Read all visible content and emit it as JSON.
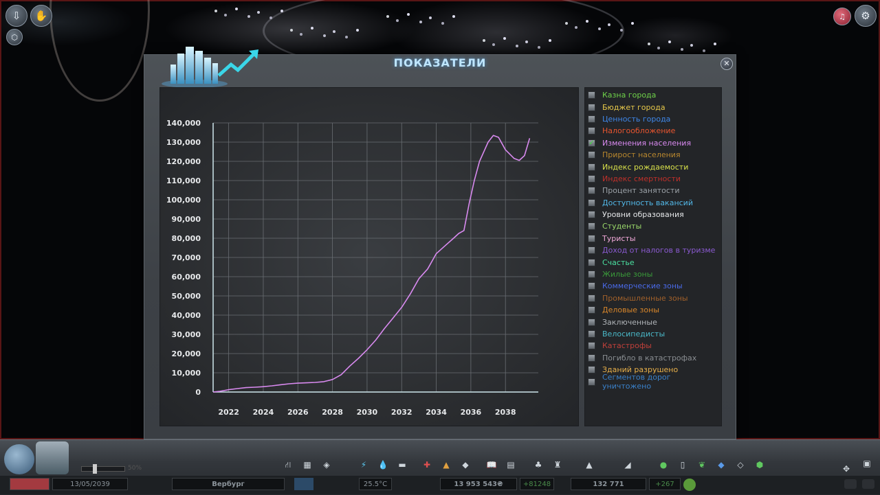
{
  "panel": {
    "title": "ПОКАЗАТЕЛИ",
    "close_icon": "✕"
  },
  "chart_data": {
    "type": "line",
    "ylim": [
      0,
      140000
    ],
    "xlim": [
      2021.1,
      2039.9
    ],
    "y_ticks": [
      "0",
      "10,000",
      "20,000",
      "30,000",
      "40,000",
      "50,000",
      "60,000",
      "70,000",
      "80,000",
      "90,000",
      "100,000",
      "110,000",
      "120,000",
      "130,000",
      "140,000"
    ],
    "x_ticks": [
      "2022",
      "2024",
      "2026",
      "2028",
      "2030",
      "2032",
      "2034",
      "2036",
      "2038"
    ],
    "grid": true,
    "series": [
      {
        "color": "#d98af0",
        "x": [
          2021.1,
          2021.5,
          2022,
          2022.5,
          2023,
          2023.5,
          2024,
          2024.5,
          2025,
          2025.5,
          2026,
          2026.5,
          2027,
          2027.5,
          2028,
          2028.5,
          2029,
          2029.5,
          2030,
          2030.5,
          2031,
          2031.5,
          2032,
          2032.5,
          2033,
          2033.5,
          2034,
          2034.5,
          2035,
          2035.3,
          2035.6,
          2035.9,
          2036.2,
          2036.5,
          2036.8,
          2037,
          2037.3,
          2037.6,
          2038,
          2038.5,
          2038.8,
          2039.1,
          2039.4
        ],
        "y": [
          0,
          400,
          1200,
          1800,
          2300,
          2500,
          2800,
          3200,
          3800,
          4300,
          4600,
          4800,
          5000,
          5400,
          6500,
          9000,
          13500,
          17500,
          22000,
          27000,
          33000,
          38500,
          44000,
          51000,
          59000,
          64000,
          72000,
          76000,
          80000,
          82500,
          84000,
          98000,
          110000,
          120000,
          126000,
          130000,
          133500,
          132500,
          126000,
          121500,
          120500,
          123000,
          132000
        ]
      }
    ]
  },
  "legend": {
    "items": [
      {
        "label": "Казна города",
        "color": "#6fd24a",
        "checked": false
      },
      {
        "label": "Бюджет города",
        "color": "#e8c94a",
        "checked": false
      },
      {
        "label": "Ценность города",
        "color": "#3f87e8",
        "checked": false
      },
      {
        "label": "Налогообложение",
        "color": "#e8552f",
        "checked": false
      },
      {
        "label": "Изменения населения",
        "color": "#d98af0",
        "checked": true
      },
      {
        "label": "Прирост населения",
        "color": "#b8872e",
        "checked": false
      },
      {
        "label": "Индекс рождаемости",
        "color": "#d8e04a",
        "checked": false
      },
      {
        "label": "Индекс смертности",
        "color": "#c0302a",
        "checked": false
      },
      {
        "label": "Процент занятости",
        "color": "#9aa0a6",
        "checked": false
      },
      {
        "label": "Доступность вакансий",
        "color": "#52b8e8",
        "checked": false
      },
      {
        "label": "Уровни образования",
        "color": "#e4e6e8",
        "checked": false
      },
      {
        "label": "Студенты",
        "color": "#9ad86a",
        "checked": false
      },
      {
        "label": "Туристы",
        "color": "#f0a8d8",
        "checked": false
      },
      {
        "label": "Доход от налогов в туризме",
        "color": "#8a5ad0",
        "checked": false
      },
      {
        "label": "Счастье",
        "color": "#4ae0a0",
        "checked": false
      },
      {
        "label": "Жилые зоны",
        "color": "#3a9a3a",
        "checked": false
      },
      {
        "label": "Коммерческие зоны",
        "color": "#4a6ae8",
        "checked": false
      },
      {
        "label": "Промышленные зоны",
        "color": "#a0602a",
        "checked": false
      },
      {
        "label": "Деловые зоны",
        "color": "#d8862a",
        "checked": false
      },
      {
        "label": "Заключенные",
        "color": "#b0b4b8",
        "checked": false
      },
      {
        "label": "Велосипедисты",
        "color": "#4ab8c8",
        "checked": false
      },
      {
        "label": "Катастрофы",
        "color": "#c0403a",
        "checked": false
      },
      {
        "label": "Погибло в катастрофах",
        "color": "#8a8e92",
        "checked": false
      },
      {
        "label": "Зданий разрушено",
        "color": "#e8b04a",
        "checked": false
      },
      {
        "label": "Сегментов дорог уничтожено",
        "color": "#3a80c8",
        "checked": false
      }
    ]
  },
  "status": {
    "date": "13/05/2039",
    "city_name": "Вербург",
    "temperature": "25.5°C",
    "money": "13 953 543₴",
    "money_delta": "+81248",
    "population": "132 771",
    "population_delta": "+267",
    "speed_label": "50%"
  }
}
